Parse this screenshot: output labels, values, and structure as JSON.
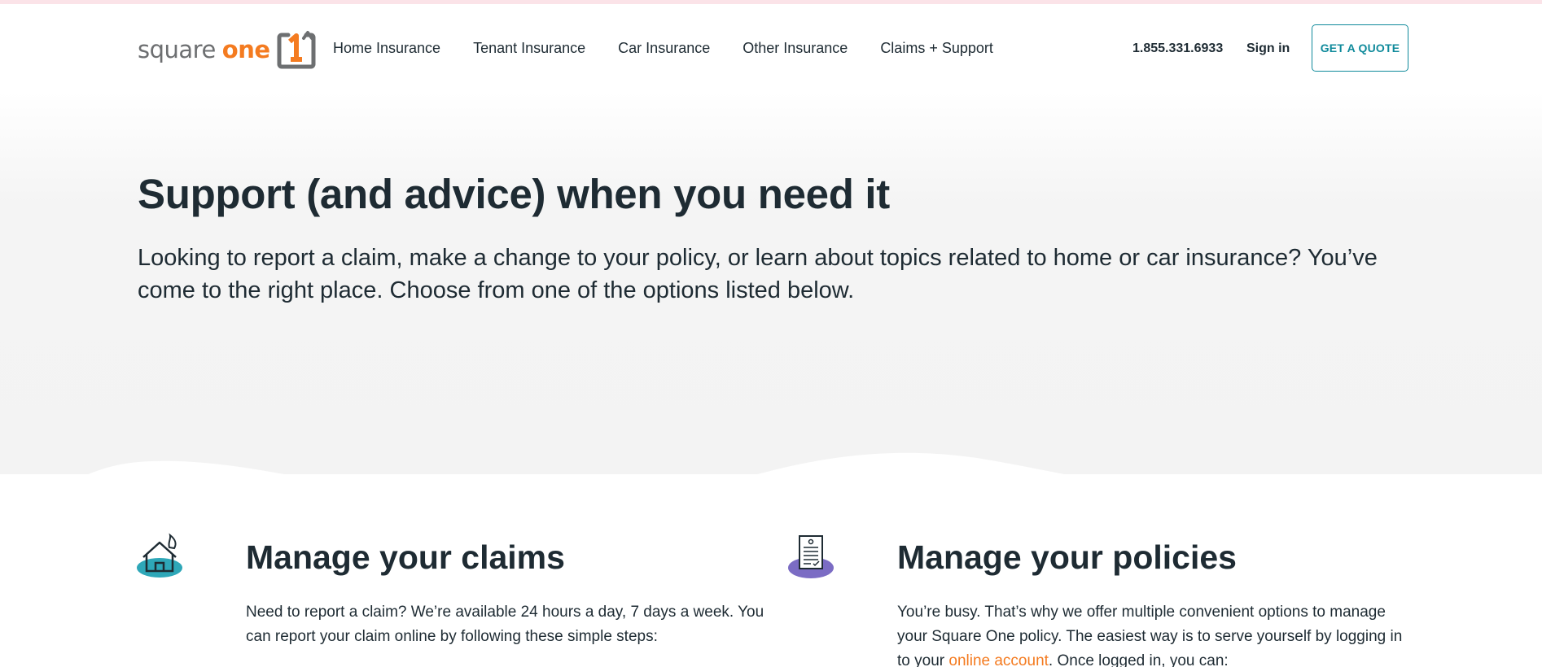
{
  "brand": {
    "logo_word1": "square",
    "logo_word2": "one",
    "accent": "#f47b20",
    "teal": "#0f8a9b",
    "text_color": "#1e2b33"
  },
  "nav": {
    "items": [
      {
        "label": "Home Insurance"
      },
      {
        "label": "Tenant Insurance"
      },
      {
        "label": "Car Insurance"
      },
      {
        "label": "Other Insurance"
      },
      {
        "label": "Claims + Support"
      }
    ],
    "phone": "1.855.331.6933",
    "signin": "Sign in",
    "quote": "GET A QUOTE"
  },
  "hero": {
    "title": "Support (and advice) when you need it",
    "subtitle": "Looking to report a claim, make a change to your policy, or learn about topics related to home or car insurance? You’ve come to the right place. Choose from one of the options listed below."
  },
  "claims": {
    "icon": "house-fire-icon",
    "title": "Manage your claims",
    "body": "Need to report a claim? We’re available 24 hours a day, 7 days a week. You can report your claim online by following these simple steps:"
  },
  "policies": {
    "icon": "policy-document-icon",
    "title": "Manage your policies",
    "body_before": "You’re busy. That’s why we offer multiple convenient options to manage your Square One policy. The easiest way is to serve yourself by logging in to your ",
    "link": "online account",
    "body_after": ". Once logged in, you can:"
  }
}
